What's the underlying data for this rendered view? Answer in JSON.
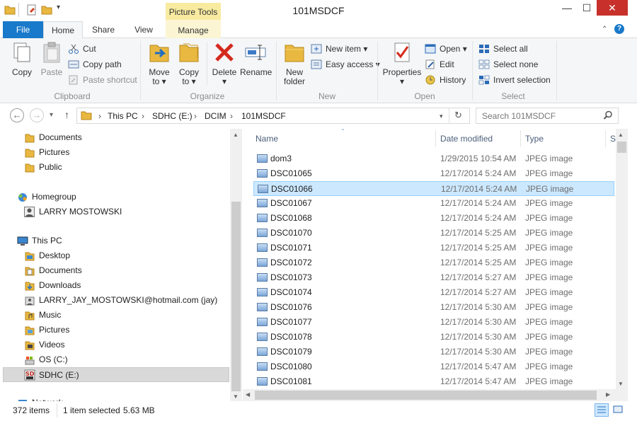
{
  "window": {
    "title": "101MSDCF",
    "contextual_tab_group": "Picture Tools",
    "controls": {
      "minimize": "—",
      "maximize": "☐",
      "close": "✕"
    }
  },
  "tabs": [
    {
      "label": "File"
    },
    {
      "label": "Home"
    },
    {
      "label": "Share"
    },
    {
      "label": "View"
    },
    {
      "label": "Manage"
    }
  ],
  "ribbon": {
    "clipboard": {
      "label": "Clipboard",
      "copy": "Copy",
      "paste": "Paste",
      "cut": "Cut",
      "copy_path": "Copy path",
      "paste_shortcut": "Paste shortcut"
    },
    "organize": {
      "label": "Organize",
      "move_to_1": "Move",
      "move_to_2": "to ▾",
      "copy_to_1": "Copy",
      "copy_to_2": "to ▾",
      "delete_1": "Delete",
      "delete_2": "▾",
      "rename": "Rename"
    },
    "new": {
      "label": "New",
      "new_folder_1": "New",
      "new_folder_2": "folder",
      "new_item": "New item ▾",
      "easy_access": "Easy access ▾"
    },
    "open": {
      "label": "Open",
      "properties": "Properties",
      "properties_arrow": "▾",
      "open": "Open ▾",
      "edit": "Edit",
      "history": "History"
    },
    "select": {
      "label": "Select",
      "select_all": "Select all",
      "select_none": "Select none",
      "invert_selection": "Invert selection"
    }
  },
  "address": {
    "crumbs": [
      "This PC",
      "SDHC (E:)",
      "DCIM",
      "101MSDCF"
    ],
    "search_placeholder": "Search 101MSDCF"
  },
  "nav": {
    "items": [
      {
        "label": "Documents"
      },
      {
        "label": "Pictures"
      },
      {
        "label": "Public"
      },
      {
        "label": "Homegroup"
      },
      {
        "label": "LARRY MOSTOWSKI"
      },
      {
        "label": "This PC"
      },
      {
        "label": "Desktop"
      },
      {
        "label": "Documents"
      },
      {
        "label": "Downloads"
      },
      {
        "label": "LARRY_JAY_MOSTOWSKI@hotmail.com (jay)"
      },
      {
        "label": "Music"
      },
      {
        "label": "Pictures"
      },
      {
        "label": "Videos"
      },
      {
        "label": "OS (C:)"
      },
      {
        "label": "SDHC (E:)"
      },
      {
        "label": "Network"
      }
    ]
  },
  "columns": {
    "name": "Name",
    "date": "Date modified",
    "type": "Type",
    "size": "S"
  },
  "files": [
    {
      "name": "dom3",
      "date": "1/29/2015 10:54 AM",
      "type": "JPEG image"
    },
    {
      "name": "DSC01065",
      "date": "12/17/2014 5:24 AM",
      "type": "JPEG image"
    },
    {
      "name": "DSC01066",
      "date": "12/17/2014 5:24 AM",
      "type": "JPEG image"
    },
    {
      "name": "DSC01067",
      "date": "12/17/2014 5:24 AM",
      "type": "JPEG image"
    },
    {
      "name": "DSC01068",
      "date": "12/17/2014 5:24 AM",
      "type": "JPEG image"
    },
    {
      "name": "DSC01070",
      "date": "12/17/2014 5:25 AM",
      "type": "JPEG image"
    },
    {
      "name": "DSC01071",
      "date": "12/17/2014 5:25 AM",
      "type": "JPEG image"
    },
    {
      "name": "DSC01072",
      "date": "12/17/2014 5:25 AM",
      "type": "JPEG image"
    },
    {
      "name": "DSC01073",
      "date": "12/17/2014 5:27 AM",
      "type": "JPEG image"
    },
    {
      "name": "DSC01074",
      "date": "12/17/2014 5:27 AM",
      "type": "JPEG image"
    },
    {
      "name": "DSC01076",
      "date": "12/17/2014 5:30 AM",
      "type": "JPEG image"
    },
    {
      "name": "DSC01077",
      "date": "12/17/2014 5:30 AM",
      "type": "JPEG image"
    },
    {
      "name": "DSC01078",
      "date": "12/17/2014 5:30 AM",
      "type": "JPEG image"
    },
    {
      "name": "DSC01079",
      "date": "12/17/2014 5:30 AM",
      "type": "JPEG image"
    },
    {
      "name": "DSC01080",
      "date": "12/17/2014 5:47 AM",
      "type": "JPEG image"
    },
    {
      "name": "DSC01081",
      "date": "12/17/2014 5:47 AM",
      "type": "JPEG image"
    }
  ],
  "selected_file": "DSC01066",
  "status": {
    "item_count": "372 items",
    "selection": "1 item selected",
    "size": "5.63 MB"
  },
  "colors": {
    "accent": "#1979ca",
    "selection": "#cce8ff",
    "close": "#c7302b",
    "folder": "#e8b840"
  }
}
